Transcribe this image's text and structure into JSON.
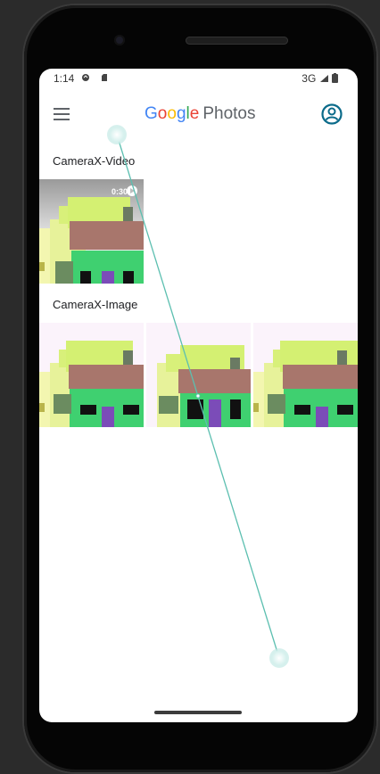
{
  "status": {
    "time": "1:14",
    "network": "3G"
  },
  "header": {
    "logo_letters": [
      {
        "char": "G",
        "color": "#4285F4"
      },
      {
        "char": "o",
        "color": "#EA4335"
      },
      {
        "char": "o",
        "color": "#FBBC05"
      },
      {
        "char": "g",
        "color": "#4285F4"
      },
      {
        "char": "l",
        "color": "#34A853"
      },
      {
        "char": "e",
        "color": "#EA4335"
      }
    ],
    "logo_suffix": "Photos",
    "account_color": "#0b6b8a"
  },
  "albums": [
    {
      "title": "CameraX-Video",
      "items": [
        {
          "type": "video",
          "duration": "0:30"
        }
      ]
    },
    {
      "title": "CameraX-Image",
      "items": [
        {
          "type": "image"
        },
        {
          "type": "image"
        },
        {
          "type": "image"
        }
      ]
    }
  ]
}
